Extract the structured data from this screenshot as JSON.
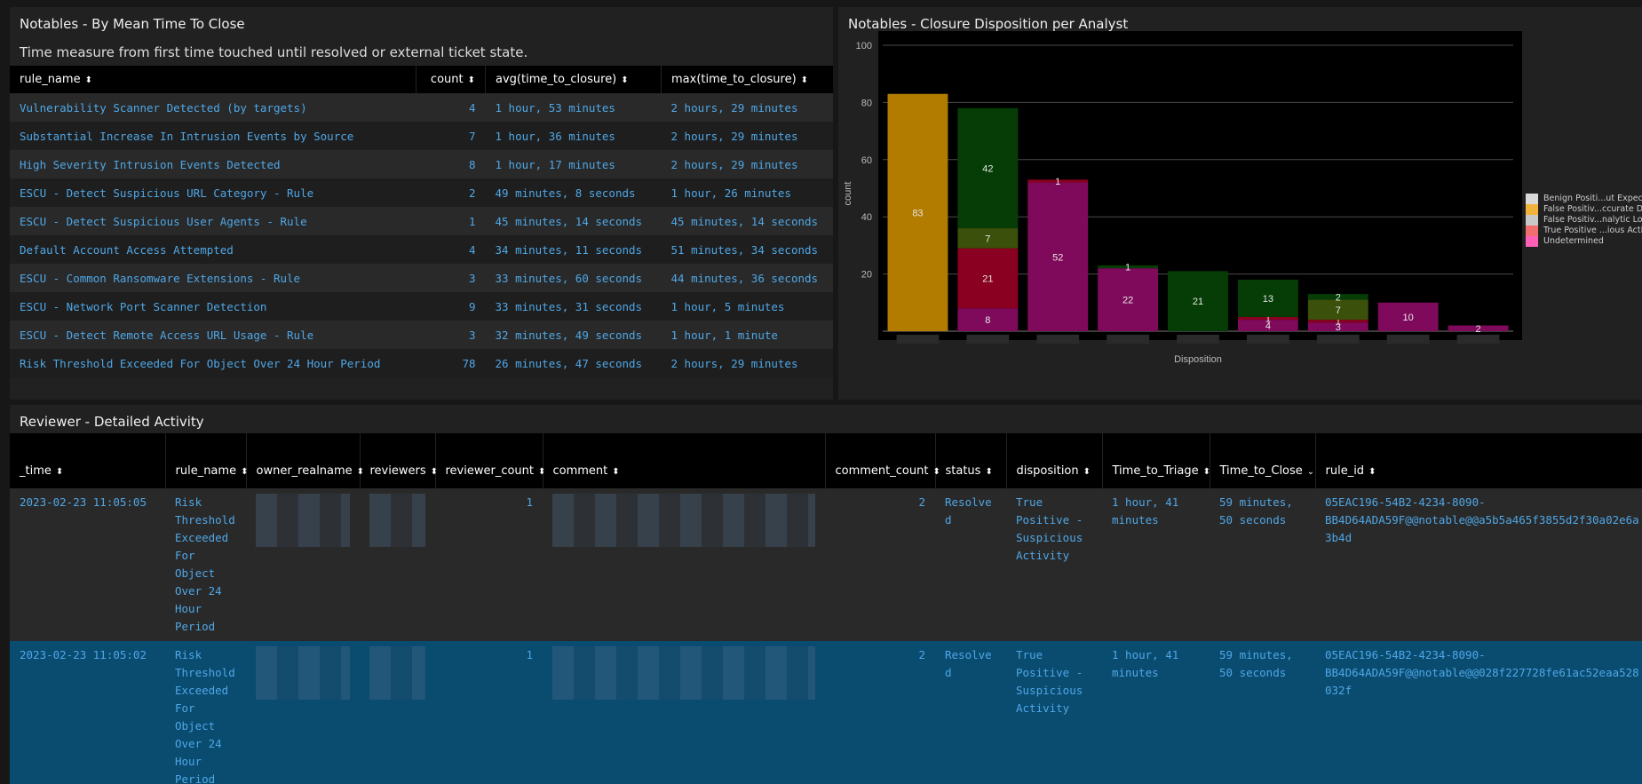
{
  "panel1": {
    "title": "Notables - By Mean Time To Close",
    "subtitle": "Time measure from first time touched until resolved or external ticket state.",
    "columns": [
      "rule_name",
      "count",
      "avg(time_to_closure)",
      "max(time_to_closure)"
    ],
    "rows": [
      [
        "Vulnerability Scanner Detected (by targets)",
        "4",
        "1 hour, 53 minutes",
        "2 hours, 29 minutes"
      ],
      [
        "Substantial Increase In Intrusion Events by Source",
        "7",
        "1 hour, 36 minutes",
        "2 hours, 29 minutes"
      ],
      [
        "High Severity Intrusion Events Detected",
        "8",
        "1 hour, 17 minutes",
        "2 hours, 29 minutes"
      ],
      [
        "ESCU - Detect Suspicious URL Category - Rule",
        "2",
        "49 minutes, 8 seconds",
        "1 hour, 26 minutes"
      ],
      [
        "ESCU - Detect Suspicious User Agents - Rule",
        "1",
        "45 minutes, 14 seconds",
        "45 minutes, 14 seconds"
      ],
      [
        "Default Account Access Attempted",
        "4",
        "34 minutes, 11 seconds",
        "51 minutes, 34 seconds"
      ],
      [
        "ESCU - Common Ransomware Extensions - Rule",
        "3",
        "33 minutes, 60 seconds",
        "44 minutes, 36 seconds"
      ],
      [
        "ESCU - Network Port Scanner Detection",
        "9",
        "33 minutes, 31 seconds",
        "1 hour, 5 minutes"
      ],
      [
        "ESCU - Detect Remote Access URL Usage - Rule",
        "3",
        "32 minutes, 49 seconds",
        "1 hour, 1 minute"
      ],
      [
        "Risk Threshold Exceeded For Object Over 24 Hour Period",
        "78",
        "26 minutes, 47 seconds",
        "2 hours, 29 minutes"
      ]
    ]
  },
  "panel2": {
    "title": "Notables - Closure Disposition per Analyst"
  },
  "chart_data": {
    "type": "bar",
    "stacked": true,
    "xlabel": "Disposition",
    "ylabel": "count",
    "ylim": [
      0,
      100
    ],
    "yticks": [
      20,
      40,
      60,
      80,
      100
    ],
    "legend_position": "right",
    "colors": {
      "benign": "#d9d9d9",
      "false_data": "#f2b33d",
      "false_logic": "#f06e6e",
      "true_positive": "#ff6ea8",
      "undetermined": "#d34fb6",
      "bar_gold": "#b27c00",
      "bar_green": "#063d06",
      "bar_olive": "#3b500a",
      "bar_red": "#8a0020",
      "bar_magenta": "#7f0a5c"
    },
    "legend": [
      {
        "name": "Benign Positi...ut Expected",
        "color": "#d9d9d9"
      },
      {
        "name": "False Positiv...ccurate Data",
        "color": "#f2b33d"
      },
      {
        "name": "False Positiv...nalytic Logic",
        "color": "#c8c8c8"
      },
      {
        "name": "True Positive ...ious Activity",
        "color": "#f06e6e"
      },
      {
        "name": "Undetermined",
        "color": "#ff5fb4"
      }
    ],
    "bars": [
      {
        "segments": [
          {
            "value": 83,
            "color": "#b27c00",
            "label": "83"
          }
        ]
      },
      {
        "segments": [
          {
            "value": 8,
            "color": "#7f0a5c",
            "label": "8"
          },
          {
            "value": 21,
            "color": "#8a0020",
            "label": "21"
          },
          {
            "value": 7,
            "color": "#3b500a",
            "label": "7"
          },
          {
            "value": 42,
            "color": "#063d06",
            "label": "42"
          }
        ]
      },
      {
        "segments": [
          {
            "value": 52,
            "color": "#7f0a5c",
            "label": "52"
          },
          {
            "value": 1,
            "color": "#8a0020",
            "label": "1"
          }
        ]
      },
      {
        "segments": [
          {
            "value": 22,
            "color": "#7f0a5c",
            "label": "22"
          },
          {
            "value": 1,
            "color": "#063d06",
            "label": "1"
          }
        ]
      },
      {
        "segments": [
          {
            "value": 21,
            "color": "#063d06",
            "label": "21"
          }
        ]
      },
      {
        "segments": [
          {
            "value": 4,
            "color": "#7f0a5c",
            "label": "4"
          },
          {
            "value": 1,
            "color": "#8a0020",
            "label": "1"
          },
          {
            "value": 13,
            "color": "#063d06",
            "label": "13"
          }
        ]
      },
      {
        "segments": [
          {
            "value": 3,
            "color": "#7f0a5c",
            "label": "3"
          },
          {
            "value": 1,
            "color": "#8a0020",
            "label": "1"
          },
          {
            "value": 7,
            "color": "#3b500a",
            "label": "7"
          },
          {
            "value": 2,
            "color": "#063d06",
            "label": "2"
          }
        ]
      },
      {
        "segments": [
          {
            "value": 10,
            "color": "#7f0a5c",
            "label": "10"
          }
        ]
      },
      {
        "segments": [
          {
            "value": 2,
            "color": "#7f0a5c",
            "label": "2"
          }
        ]
      }
    ]
  },
  "panel3": {
    "title": "Reviewer - Detailed Activity",
    "columns": [
      "_time",
      "rule_name",
      "owner_realname",
      "reviewers",
      "reviewer_count",
      "comment",
      "comment_count",
      "status",
      "disposition",
      "Time_to_Triage",
      "Time_to_Close",
      "rule_id"
    ],
    "rows": [
      {
        "time": "2023-02-23 11:05:05",
        "rule_name": "Risk Threshold Exceeded For Object Over 24 Hour Period",
        "reviewer_count": "1",
        "comment_count": "2",
        "status": "Resolved",
        "disposition": "True Positive - Suspicious Activity",
        "triage": "1 hour, 41 minutes",
        "close": "59 minutes, 50 seconds",
        "rule_id": "05EAC196-54B2-4234-8090-BB4D64ADA59F@@notable@@a5b5a465f3855d2f30a02e6a3b4d"
      },
      {
        "time": "2023-02-23 11:05:02",
        "rule_name": "Risk Threshold Exceeded For Object Over 24 Hour Period",
        "reviewer_count": "1",
        "comment_count": "2",
        "status": "Resolved",
        "disposition": "True Positive - Suspicious Activity",
        "triage": "1 hour, 41 minutes",
        "close": "59 minutes, 50 seconds",
        "rule_id": "05EAC196-54B2-4234-8090-BB4D64ADA59F@@notable@@028f227728fe61ac52eaa528032f"
      }
    ]
  }
}
